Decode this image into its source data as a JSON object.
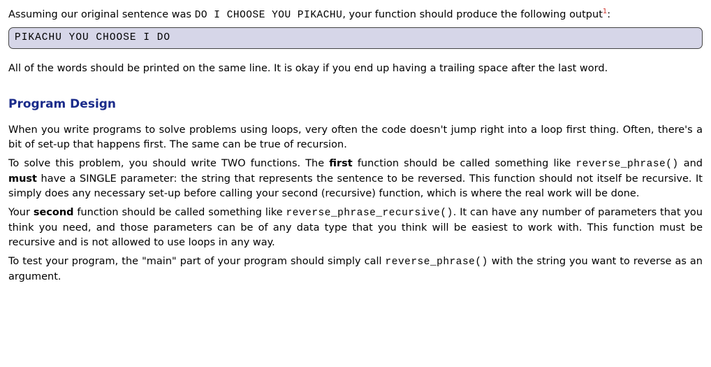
{
  "intro": {
    "part1": "Assuming our original sentence was ",
    "code": "DO I CHOOSE YOU PIKACHU",
    "part2": ", your function should produce the following output",
    "footnote": "1",
    "part3": ":"
  },
  "code_block": "PIKACHU YOU CHOOSE I DO",
  "after_code": "All of the words should be printed on the same line. It is okay if you end up having a trailing space after the last word.",
  "heading": "Program Design",
  "p1": "When you write programs to solve problems using loops, very often the code doesn't jump right into a loop first thing. Often, there's a bit of set-up that happens first. The same can be true of recursion.",
  "p2": {
    "a": "To solve this problem, you should write TWO functions. The ",
    "first": "first",
    "b": " function should be called something like ",
    "code1": "reverse_phrase()",
    "c": " and ",
    "must": "must",
    "d": " have a SINGLE parameter: the string that represents the sentence to be reversed. This function should not itself be recursive. It simply does any necessary set-up before calling your second (recursive) function, which is where the real work will be done."
  },
  "p3": {
    "a": "Your ",
    "second": "second",
    "b": " function should be called something like ",
    "code1": "reverse_phrase_recursive()",
    "c": ". It can have any number of parameters that you think you need, and those parameters can be of any data type that you think will be easiest to work with. This function must be recursive and is not allowed to use loops in any way."
  },
  "p4": {
    "a": "To test your program, the \"main\" part of your program should simply call ",
    "code1": "reverse_phrase()",
    "b": " with the string you want to reverse as an argument."
  }
}
